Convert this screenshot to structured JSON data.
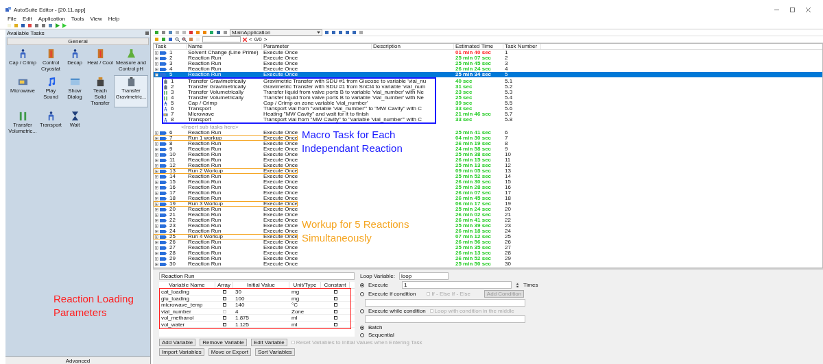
{
  "window": {
    "title": "AutoSuite Editor - [20.11.app]"
  },
  "menu": [
    "File",
    "Edit",
    "Application",
    "Tools",
    "View",
    "Help"
  ],
  "tasks_panel": {
    "title": "Available Tasks",
    "group": "General",
    "footer": "Advanced",
    "items": [
      {
        "label": "Cap / Crimp",
        "kind": "figure",
        "selected": false
      },
      {
        "label": "Control Cryostat",
        "kind": "thermometer",
        "selected": false
      },
      {
        "label": "Decap",
        "kind": "figure",
        "selected": false
      },
      {
        "label": "Heat / Cool",
        "kind": "thermometer",
        "selected": false
      },
      {
        "label": "Measure and Control pH",
        "kind": "flask",
        "selected": false
      },
      {
        "label": "Microwave",
        "kind": "oven",
        "selected": false
      },
      {
        "label": "Play Sound",
        "kind": "note",
        "selected": false
      },
      {
        "label": "Show Dialog",
        "kind": "window",
        "selected": false
      },
      {
        "label": "Teach Solid Transfer",
        "kind": "bottle",
        "selected": false
      },
      {
        "label": "Transfer Gravimetric...",
        "kind": "jar",
        "selected": true
      },
      {
        "label": "Transfer Volumetric...",
        "kind": "tubes",
        "selected": false
      },
      {
        "label": "Transport",
        "kind": "figure",
        "selected": false
      },
      {
        "label": "Wait",
        "kind": "hourglass",
        "selected": false
      }
    ]
  },
  "toolbar": {
    "application": "MainApplication",
    "counter": "0/0",
    "prev": "<",
    "next": ">"
  },
  "table": {
    "columns": [
      "Task",
      "Name",
      "Parameter",
      "Description",
      "Estimated Time",
      "Task Number"
    ],
    "rows": [
      {
        "id": "1",
        "name": "Solvent Change (Line Prime)",
        "parameter": "Execute Once",
        "time": "01 min 40 sec",
        "color": "#ff2020",
        "number": "1",
        "expanded": false,
        "selected": false,
        "outlined": false
      },
      {
        "id": "2",
        "name": "Reaction Run",
        "parameter": "Execute Once",
        "time": "25 min 07 sec",
        "color": "#22cc22",
        "number": "2",
        "expanded": false,
        "selected": false,
        "outlined": false
      },
      {
        "id": "3",
        "name": "Reaction Run",
        "parameter": "Execute Once",
        "time": "25 min 45 sec",
        "color": "#22cc22",
        "number": "3",
        "expanded": false,
        "selected": false,
        "outlined": false
      },
      {
        "id": "4",
        "name": "Reaction Run",
        "parameter": "Execute Once",
        "time": "26 min 24 sec",
        "color": "#22cc22",
        "number": "4",
        "expanded": false,
        "selected": false,
        "outlined": false
      },
      {
        "id": "5",
        "name": "Reaction Run",
        "parameter": "Execute Once",
        "time": "25 min 34 sec",
        "number": "5",
        "expanded": true,
        "selected": true,
        "outlined": false,
        "children_outlined": true,
        "insert_hint": "<Insert sub tasks here>",
        "children": [
          {
            "id": "1",
            "kind": "jar",
            "name": "Transfer Gravimetrically",
            "parameter": "Gravimetric Transfer with SDU #1 from Glucose to variable 'vial_nu",
            "time": "40 sec",
            "color": "#22cc22",
            "number": "5.1"
          },
          {
            "id": "2",
            "kind": "jar",
            "name": "Transfer Gravimetrically",
            "parameter": "Gravimetric Transfer with SDU #1 from SnCl4 to variable 'vial_num",
            "time": "31 sec",
            "color": "#22cc22",
            "number": "5.2"
          },
          {
            "id": "3",
            "kind": "tubes",
            "name": "Transfer Volumetrically",
            "parameter": "Transfer liquid from valve ports B to variable 'vial_number' with Ne",
            "time": "23 sec",
            "color": "#22cc22",
            "number": "5.3"
          },
          {
            "id": "4",
            "kind": "tubes",
            "name": "Transfer Volumetrically",
            "parameter": "Transfer liquid from valve ports B to variable 'vial_number' with Ne",
            "time": "25 sec",
            "color": "#22cc22",
            "number": "5.4"
          },
          {
            "id": "5",
            "kind": "figure",
            "name": "Cap / Crimp",
            "parameter": "Cap / Crimp on zone variable 'vial_number'",
            "time": "39 sec",
            "color": "#22cc22",
            "number": "5.5"
          },
          {
            "id": "6",
            "kind": "figure",
            "name": "Transport",
            "parameter": "Transport vial from \"variable 'vial_number'\" to \"MW Cavity\" with C",
            "time": "33 sec",
            "color": "#22cc22",
            "number": "5.6"
          },
          {
            "id": "7",
            "kind": "oven",
            "name": "Microwave",
            "parameter": "Heating \"MW Cavity\" and wait for it to finish",
            "time": "21 min 46 sec",
            "color": "#22cc22",
            "number": "5.7"
          },
          {
            "id": "8",
            "kind": "figure",
            "name": "Transport",
            "parameter": "Transport vial from \"MW Cavity\" to \"variable 'vial_number'\" with C",
            "time": "33 sec",
            "color": "#22cc22",
            "number": "5.8"
          }
        ]
      },
      {
        "id": "6",
        "name": "Reaction Run",
        "parameter": "Execute Once",
        "time": "25 min 41 sec",
        "color": "#22cc22",
        "number": "6",
        "expanded": false,
        "selected": false,
        "outlined": false
      },
      {
        "id": "7",
        "name": "Run 1 workup",
        "parameter": "Execute Once",
        "time": "04 min 30 sec",
        "color": "#22cc22",
        "number": "7",
        "expanded": false,
        "selected": false,
        "outlined": true
      },
      {
        "id": "8",
        "name": "Reaction Run",
        "parameter": "Execute Once",
        "time": "26 min 19 sec",
        "color": "#22cc22",
        "number": "8",
        "expanded": false,
        "selected": false,
        "outlined": false
      },
      {
        "id": "9",
        "name": "Reaction Run",
        "parameter": "Execute Once",
        "time": "24 min 58 sec",
        "color": "#22cc22",
        "number": "9",
        "expanded": false,
        "selected": false,
        "outlined": false
      },
      {
        "id": "10",
        "name": "Reaction Run",
        "parameter": "Execute Once",
        "time": "25 min 38 sec",
        "color": "#22cc22",
        "number": "10",
        "expanded": false,
        "selected": false,
        "outlined": false
      },
      {
        "id": "11",
        "name": "Reaction Run",
        "parameter": "Execute Once",
        "time": "26 min 15 sec",
        "color": "#22cc22",
        "number": "11",
        "expanded": false,
        "selected": false,
        "outlined": false
      },
      {
        "id": "12",
        "name": "Reaction Run",
        "parameter": "Execute Once",
        "time": "25 min 13 sec",
        "color": "#22cc22",
        "number": "12",
        "expanded": false,
        "selected": false,
        "outlined": false
      },
      {
        "id": "13",
        "name": "Run 2 Workup",
        "parameter": "Execute Once",
        "time": "09 min 05 sec",
        "color": "#22cc22",
        "number": "13",
        "expanded": false,
        "selected": false,
        "outlined": true
      },
      {
        "id": "14",
        "name": "Reaction Run",
        "parameter": "Execute Once",
        "time": "25 min 52 sec",
        "color": "#22cc22",
        "number": "14",
        "expanded": false,
        "selected": false,
        "outlined": false
      },
      {
        "id": "15",
        "name": "Reaction Run",
        "parameter": "Execute Once",
        "time": "26 min 30 sec",
        "color": "#22cc22",
        "number": "15",
        "expanded": false,
        "selected": false,
        "outlined": false
      },
      {
        "id": "16",
        "name": "Reaction Run",
        "parameter": "Execute Once",
        "time": "25 min 28 sec",
        "color": "#22cc22",
        "number": "16",
        "expanded": false,
        "selected": false,
        "outlined": false
      },
      {
        "id": "17",
        "name": "Reaction Run",
        "parameter": "Execute Once",
        "time": "26 min 07 sec",
        "color": "#22cc22",
        "number": "17",
        "expanded": false,
        "selected": false,
        "outlined": false
      },
      {
        "id": "18",
        "name": "Reaction Run",
        "parameter": "Execute Once",
        "time": "26 min 45 sec",
        "color": "#22cc22",
        "number": "18",
        "expanded": false,
        "selected": false,
        "outlined": false
      },
      {
        "id": "19",
        "name": "Run 3 Workup",
        "parameter": "Execute Once",
        "time": "06 min 17 sec",
        "color": "#22cc22",
        "number": "19",
        "expanded": false,
        "selected": false,
        "outlined": true
      },
      {
        "id": "20",
        "name": "Reaction Run",
        "parameter": "Execute Once",
        "time": "25 min 24 sec",
        "color": "#22cc22",
        "number": "20",
        "expanded": false,
        "selected": false,
        "outlined": false
      },
      {
        "id": "21",
        "name": "Reaction Run",
        "parameter": "Execute Once",
        "time": "26 min 02 sec",
        "color": "#22cc22",
        "number": "21",
        "expanded": false,
        "selected": false,
        "outlined": false
      },
      {
        "id": "22",
        "name": "Reaction Run",
        "parameter": "Execute Once",
        "time": "26 min 41 sec",
        "color": "#22cc22",
        "number": "22",
        "expanded": false,
        "selected": false,
        "outlined": false
      },
      {
        "id": "23",
        "name": "Reaction Run",
        "parameter": "Execute Once",
        "time": "25 min 39 sec",
        "color": "#22cc22",
        "number": "23",
        "expanded": false,
        "selected": false,
        "outlined": false
      },
      {
        "id": "24",
        "name": "Reaction Run",
        "parameter": "Execute Once",
        "time": "26 min 18 sec",
        "color": "#22cc22",
        "number": "24",
        "expanded": false,
        "selected": false,
        "outlined": false
      },
      {
        "id": "25",
        "name": "Run 4 Workup",
        "parameter": "Execute Once",
        "time": "07 min 12 sec",
        "color": "#22cc22",
        "number": "25",
        "expanded": false,
        "selected": false,
        "outlined": true
      },
      {
        "id": "26",
        "name": "Reaction Run",
        "parameter": "Execute Once",
        "time": "26 min 56 sec",
        "color": "#22cc22",
        "number": "26",
        "expanded": false,
        "selected": false,
        "outlined": false
      },
      {
        "id": "27",
        "name": "Reaction Run",
        "parameter": "Execute Once",
        "time": "25 min 35 sec",
        "color": "#22cc22",
        "number": "27",
        "expanded": false,
        "selected": false,
        "outlined": false
      },
      {
        "id": "28",
        "name": "Reaction Run",
        "parameter": "Execute Once",
        "time": "26 min 13 sec",
        "color": "#22cc22",
        "number": "28",
        "expanded": false,
        "selected": false,
        "outlined": false
      },
      {
        "id": "29",
        "name": "Reaction Run",
        "parameter": "Execute Once",
        "time": "26 min 52 sec",
        "color": "#22cc22",
        "number": "29",
        "expanded": false,
        "selected": false,
        "outlined": false
      },
      {
        "id": "30",
        "name": "Reaction Run",
        "parameter": "Execute Once",
        "time": "25 min 50 sec",
        "color": "#22cc22",
        "number": "30",
        "expanded": false,
        "selected": false,
        "outlined": false
      }
    ]
  },
  "details": {
    "task_name": "Reaction Run",
    "variables": {
      "outlined": true,
      "columns": [
        "Variable Name",
        "Array",
        "Initial Value",
        "Unit/Type",
        "Constant"
      ],
      "rows": [
        {
          "name": "cat_loading",
          "array": false,
          "array_disabled": false,
          "value": "30",
          "unit": "mg",
          "constant": false
        },
        {
          "name": "glu_loading",
          "array": false,
          "array_disabled": false,
          "value": "100",
          "unit": "mg",
          "constant": false
        },
        {
          "name": "microwave_temp",
          "array": false,
          "array_disabled": false,
          "value": "140",
          "unit": "°C",
          "constant": false
        },
        {
          "name": "vial_number",
          "array": false,
          "array_disabled": true,
          "value": "4",
          "unit": "Zone",
          "constant": false
        },
        {
          "name": "vol_methanol",
          "array": false,
          "array_disabled": false,
          "value": "1.875",
          "unit": "ml",
          "constant": false
        },
        {
          "name": "vol_water",
          "array": false,
          "array_disabled": false,
          "value": "1.125",
          "unit": "ml",
          "constant": false
        }
      ]
    },
    "buttons_row1": [
      "Add Variable",
      "Remove Variable",
      "Edit Variable"
    ],
    "reset_option": {
      "label": "Reset Variables to Initial Values when Entering Task",
      "checked": false,
      "disabled": true
    },
    "buttons_row2": [
      "Import Variables",
      "Move or Export",
      "Sort Variables"
    ],
    "loop_variable": {
      "label": "Loop Variable:",
      "value": "loop"
    },
    "execute": {
      "label": "Execute",
      "selected": true,
      "value": "1",
      "unit": "Times"
    },
    "execute_if": {
      "label": "Execute if condition",
      "selected": false,
      "option": {
        "label": "If - Else If - Else",
        "checked": false,
        "disabled": true
      },
      "button": {
        "label": "Add Condition",
        "disabled": true
      }
    },
    "execute_while": {
      "label": "Execute while condition",
      "selected": false,
      "option": {
        "label": "Loop with condition in the middle",
        "checked": false,
        "disabled": true
      }
    },
    "modes": [
      {
        "label": "Batch",
        "selected": true
      },
      {
        "label": "Sequential",
        "selected": false
      }
    ]
  },
  "annotations": {
    "macro": "Macro Task for Each Independant Reaction",
    "workup": "Workup for 5 Reactions Simultaneously",
    "loading": "Reaction Loading Parameters"
  }
}
